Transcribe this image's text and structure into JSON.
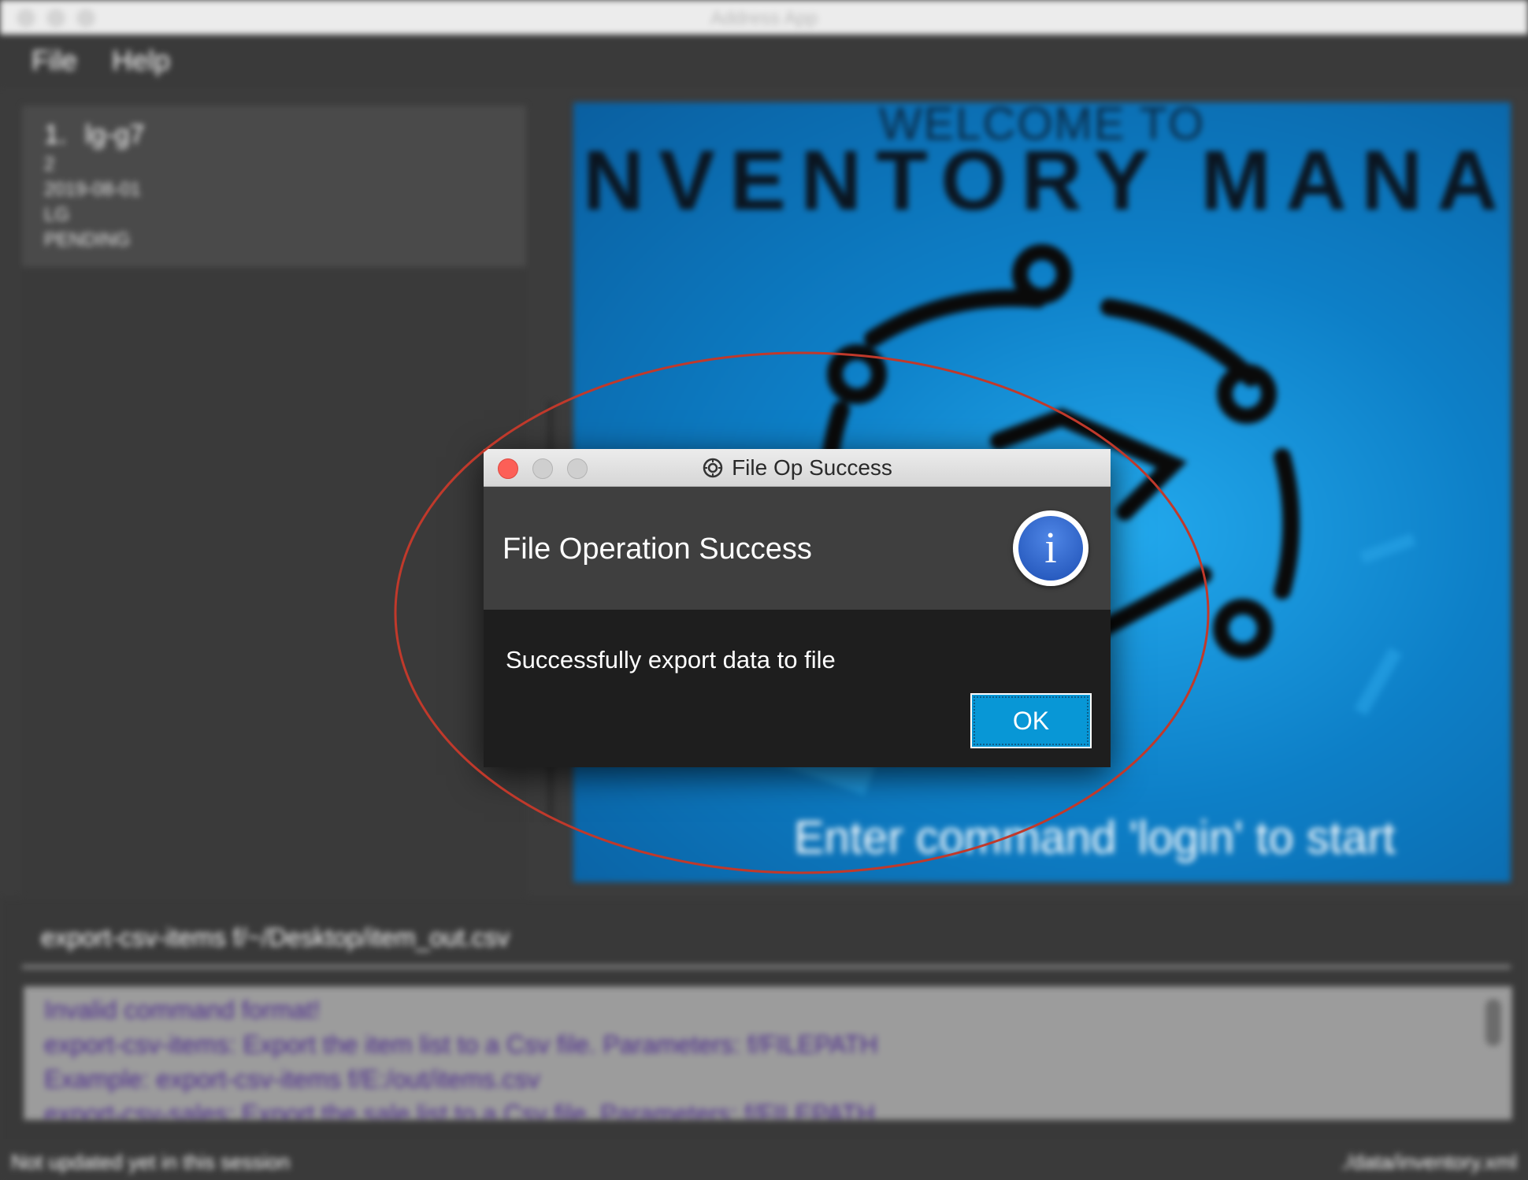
{
  "window": {
    "title": "Address App"
  },
  "menu": {
    "file": "File",
    "help": "Help"
  },
  "item_list": [
    {
      "index": "1.",
      "name": "lg-g7",
      "quantity": "2",
      "date": "2019-08-01",
      "brand": "LG",
      "status": "PENDING"
    }
  ],
  "welcome": {
    "line1": "WELCOME TO",
    "line2": "NVENTORY MANAGER",
    "line3": "Enter command 'login' to start"
  },
  "command": {
    "value": "export-csv-items f/~/Desktop/item_out.csv"
  },
  "result": {
    "lines": [
      "Invalid command format!",
      "export-csv-items: Export the item list to a Csv file. Parameters: f/FILEPATH",
      "Example: export-csv-items f/E:/out/items.csv",
      "export-csv-sales: Export the sale list to a Csv file. Parameters: f/FILEPATH"
    ]
  },
  "status": {
    "left": "Not updated yet in this session",
    "right": "./data/inventory.xml"
  },
  "dialog": {
    "title": "File Op Success",
    "heading": "File Operation Success",
    "message": "Successfully export data to file",
    "ok_label": "OK",
    "icon": "info-icon"
  },
  "colors": {
    "annotation": "#c0392b",
    "ok_button": "#0897d6",
    "close_light": "#fc5f57"
  }
}
